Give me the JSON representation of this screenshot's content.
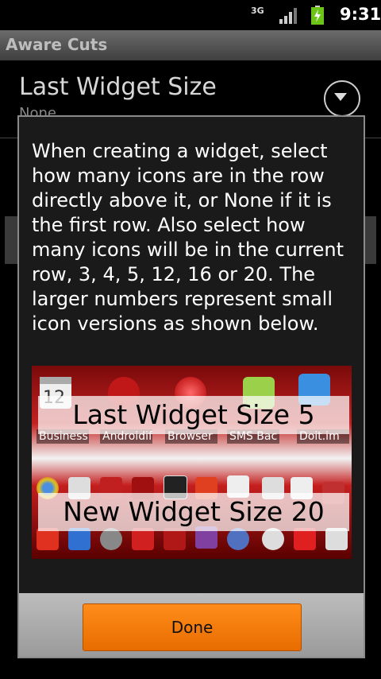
{
  "status_bar": {
    "network": "3G",
    "time": "9:31"
  },
  "app": {
    "title": "Aware Cuts"
  },
  "background": {
    "preference_title": "Last Widget Size",
    "preference_summary": "None"
  },
  "dialog": {
    "message": "When creating a widget, select how many icons are in the row directly above it, or None if it is the first row. Also select how many icons will be in the current row, 3, 4, 5, 12, 16 or 20. The larger numbers represent small icon versions as shown below.",
    "preview": {
      "top_label": "Last Widget Size 5",
      "bottom_label": "New Widget Size 20",
      "apps": [
        "Business",
        "Androidif",
        "Browser",
        "SMS Bac",
        "Doit.im"
      ],
      "calendar_day": "12"
    },
    "done_label": "Done"
  },
  "colors": {
    "accent_button": "#f07800",
    "status_battery": "#6cc417"
  }
}
